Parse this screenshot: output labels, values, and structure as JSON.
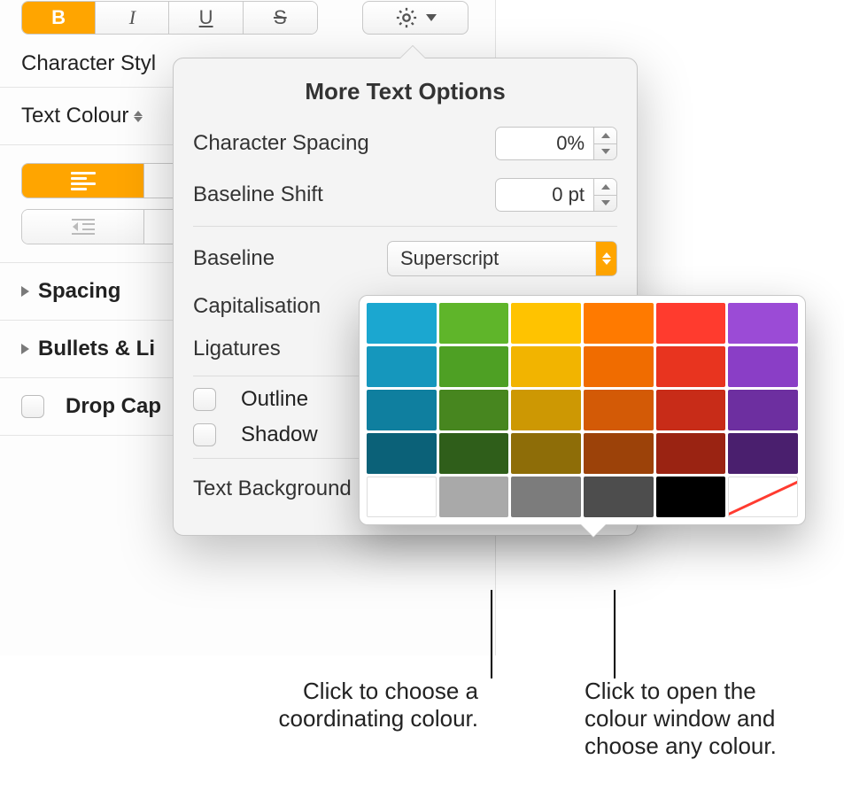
{
  "toolbar": {
    "bold": "B",
    "italic": "I",
    "underline": "U",
    "strike": "S"
  },
  "sidebar": {
    "charStyle": "Character Styl",
    "textColour": "Text Colour",
    "spacing": "Spacing",
    "bullets": "Bullets & Li",
    "dropcap": "Drop Cap"
  },
  "popover": {
    "title": "More Text Options",
    "charSpacing": "Character Spacing",
    "charSpacingVal": "0%",
    "baselineShift": "Baseline Shift",
    "baselineShiftVal": "0 pt",
    "baseline": "Baseline",
    "baselineVal": "Superscript",
    "capitalisation": "Capitalisation",
    "ligatures": "Ligatures",
    "outline": "Outline",
    "shadow": "Shadow",
    "textBackground": "Text Background"
  },
  "callouts": {
    "left": "Click to choose a coordinating colour.",
    "right": "Click to open the colour window and choose any colour."
  },
  "swatches": {
    "row1": [
      "#1ba7d0",
      "#5fb52a",
      "#ffc300",
      "#ff7a00",
      "#ff3b2e",
      "#9b4bd6"
    ],
    "row2": [
      "#1597bd",
      "#4ea024",
      "#f2b400",
      "#f06c00",
      "#e8341f",
      "#8a3ec6"
    ],
    "row3": [
      "#0f7f9f",
      "#47861f",
      "#cd9803",
      "#d35a06",
      "#c82c18",
      "#6d2fa0"
    ],
    "row4": [
      "#0b6178",
      "#2f5e1a",
      "#8e6d08",
      "#9c4209",
      "#9a2312",
      "#4a1f6e"
    ],
    "gray": [
      "#ffffff",
      "#a9a9a9",
      "#7c7c7c",
      "#4d4d4d",
      "#000000",
      "none"
    ]
  }
}
